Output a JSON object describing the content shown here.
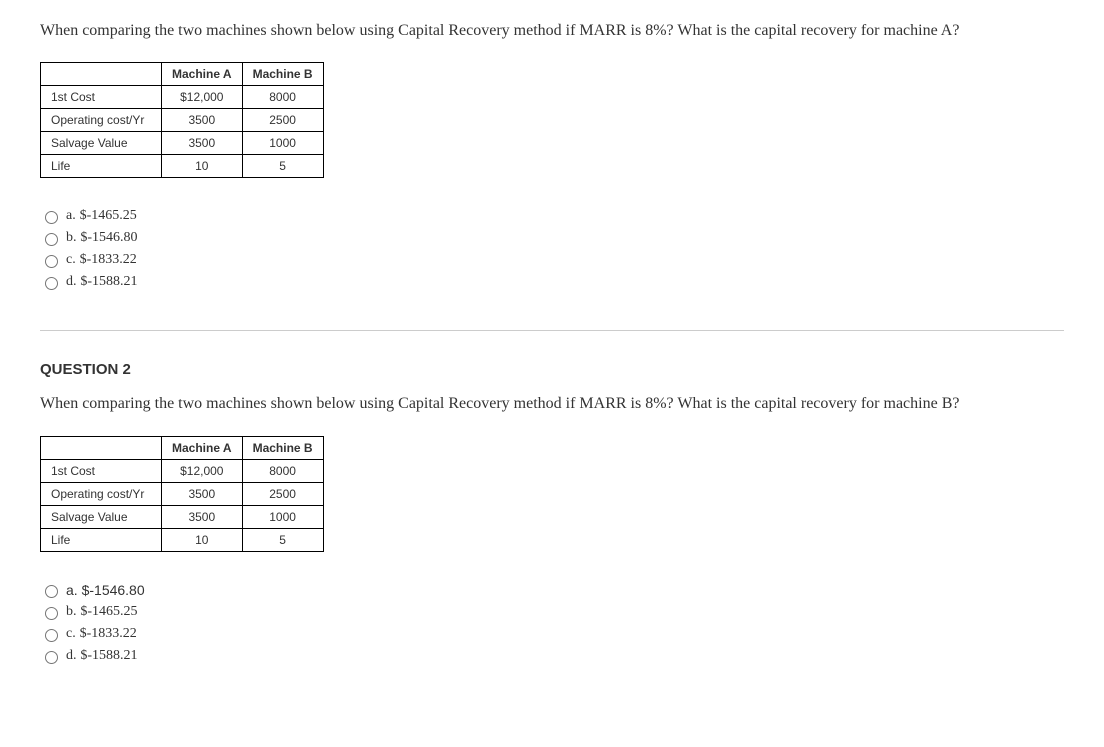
{
  "q1": {
    "prompt": "When comparing the two machines shown below using Capital Recovery method if MARR is 8%? What is the capital recovery for machine A?",
    "table": {
      "headers": [
        "Machine A",
        "Machine B"
      ],
      "rows": [
        {
          "label": "1st Cost",
          "a": "$12,000",
          "b": "8000"
        },
        {
          "label": "Operating cost/Yr",
          "a": "3500",
          "b": "2500"
        },
        {
          "label": "Salvage Value",
          "a": "3500",
          "b": "1000"
        },
        {
          "label": "Life",
          "a": "10",
          "b": "5"
        }
      ]
    },
    "options": [
      {
        "letter": "a.",
        "text": "$-1465.25",
        "sans": false
      },
      {
        "letter": "b.",
        "text": "$-1546.80",
        "sans": false
      },
      {
        "letter": "c.",
        "text": "$-1833.22",
        "sans": false
      },
      {
        "letter": "d.",
        "text": "$-1588.21",
        "sans": false
      }
    ]
  },
  "q2": {
    "heading": "QUESTION 2",
    "prompt": "When comparing the two machines shown below using Capital Recovery method if MARR is 8%? What is the capital recovery for machine B?",
    "table": {
      "headers": [
        "Machine A",
        "Machine B"
      ],
      "rows": [
        {
          "label": "1st Cost",
          "a": "$12,000",
          "b": "8000"
        },
        {
          "label": "Operating cost/Yr",
          "a": "3500",
          "b": "2500"
        },
        {
          "label": "Salvage Value",
          "a": "3500",
          "b": "1000"
        },
        {
          "label": "Life",
          "a": "10",
          "b": "5"
        }
      ]
    },
    "options": [
      {
        "letter": "a.",
        "text": "$-1546.80",
        "sans": true
      },
      {
        "letter": "b.",
        "text": "$-1465.25",
        "sans": false
      },
      {
        "letter": "c.",
        "text": "$-1833.22",
        "sans": false
      },
      {
        "letter": "d.",
        "text": "$-1588.21",
        "sans": false
      }
    ]
  }
}
